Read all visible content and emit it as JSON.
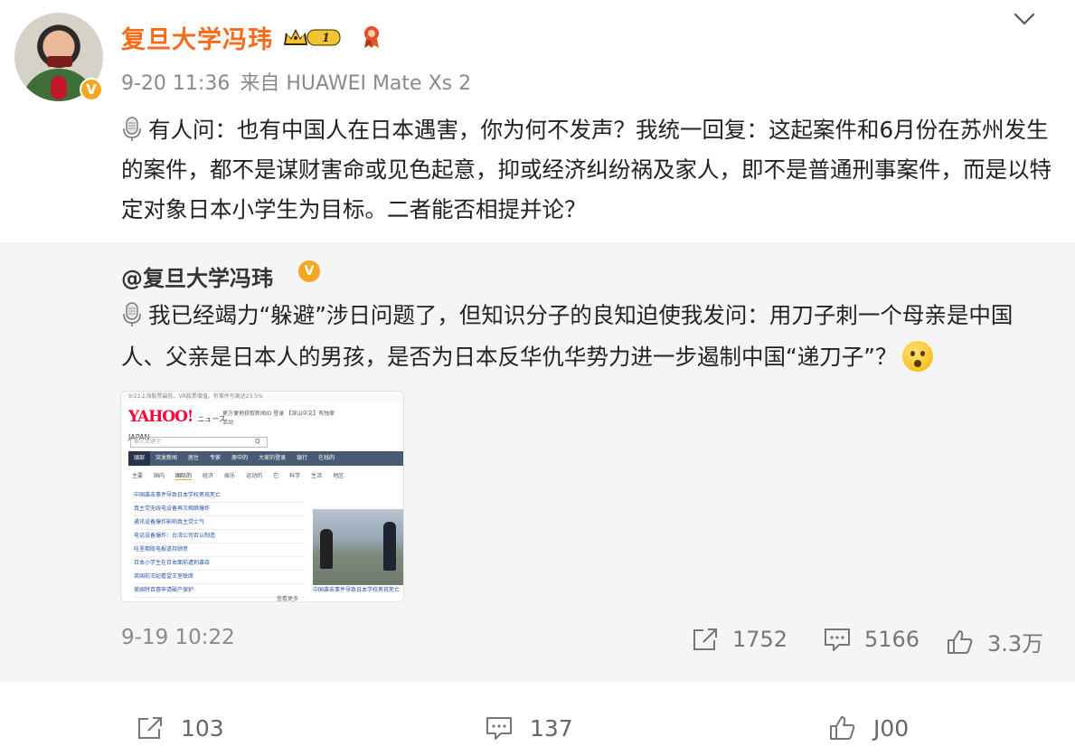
{
  "post": {
    "username": "复旦大学冯玮",
    "level_badge": "1",
    "verified_mark": "V",
    "date": "9-20 11:36",
    "source": "来自 HUAWEI Mate Xs 2",
    "text": "有人问：也有中国人在日本遇害，你为何不发声？我统一回复：这起案件和6月份在苏州发生的案件，都不是谋财害命或见色起意，抑或经济纠纷祸及家人，即不是普通刑事案件，而是以特定对象日本小学生为目标。二者能否相提并论？"
  },
  "repost": {
    "username": "@复旦大学冯玮",
    "verified_mark": "V",
    "text": "我已经竭力“躲避”涉日问题了，但知识分子的良知迫使我发问：用刀子刺一个母亲是中国人、父亲是日本人的男孩，是否为日本反华仇华势力进一步遏制中国“递刀子”？",
    "date": "9-19 10:22",
    "reposts": "1752",
    "comments": "5166",
    "likes": "3.3万",
    "thumbnail": {
      "logo": "YAHOO!",
      "logo_sub": "JAPAN",
      "logo_suffix": "ニュース",
      "top_note": "9/22上海股票最低，VR股票增值，有事件写高达23.5%",
      "header_note": "更方便地获取新闻ID 登录 【深山中文】有独家活动",
      "search_placeholder": "输入关键字",
      "search_icon": "Q",
      "nav": [
        "頭部",
        "突发新闻",
        "居住",
        "专家",
        "原中的",
        "大家的登录",
        "银行",
        "在线的"
      ],
      "subnav": [
        "主要",
        "国内",
        "国际的",
        "经济",
        "娱乐",
        "运动的",
        "它",
        "科学",
        "生活",
        "地区"
      ],
      "list": [
        "中国袭击事件导致日本学校男孩死亡",
        "真主党无线电设备再次相继爆炸",
        "通讯设备爆炸影响真主党士气",
        "电话设备爆炸：台湾公司否认制造",
        "哇里期败电报道持顾意",
        "日本小学生在日本面前遭刺袭击",
        "英国前王妃看望王室联席",
        "美国特百惠申请破产保护"
      ],
      "more": "查看更多",
      "photo_caption": "中国袭击事件导致日本学校男孩死亡"
    }
  },
  "bottom": {
    "reposts": "103",
    "comments": "137",
    "likes": "J00"
  },
  "icons": {
    "chevron": "chevron-down-icon",
    "repost": "share-arrow-icon",
    "comment": "comment-bubble-icon",
    "like": "thumbs-up-icon",
    "mic": "microphone-icon"
  },
  "colors": {
    "username": "#f86b1b",
    "badge": "#f5a623",
    "meta": "#8a8a8a",
    "repost_bg": "#f5f5f5"
  }
}
